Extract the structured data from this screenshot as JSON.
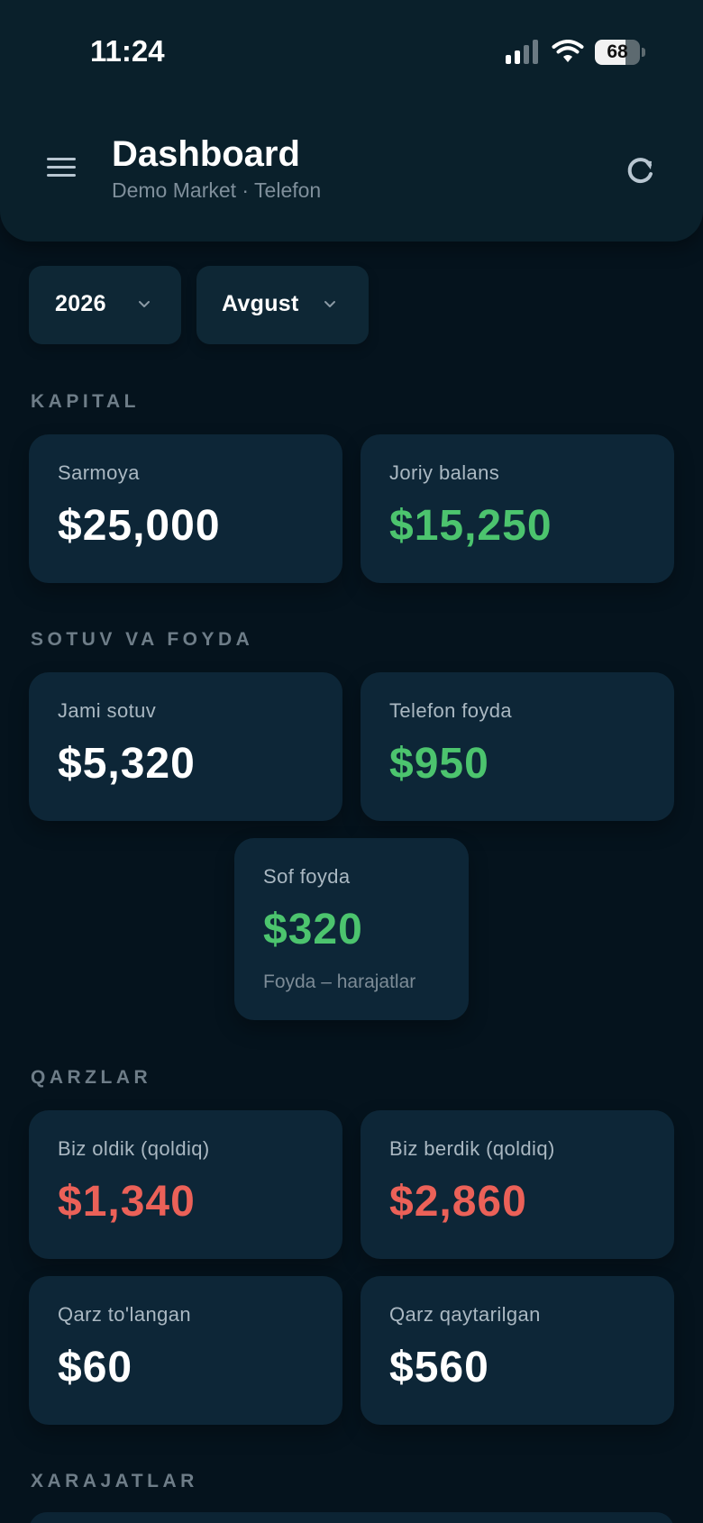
{
  "status_bar": {
    "time": "11:24",
    "battery_level": "68"
  },
  "header": {
    "title": "Dashboard",
    "subtitle": "Demo Market · Telefon"
  },
  "filters": {
    "year": "2026",
    "month": "Avgust"
  },
  "sections": {
    "capital": "KAPITAL",
    "sales_profit": "SOTUV VA FOYDA",
    "debts": "QARZLAR",
    "expenses": "XARAJATLAR"
  },
  "capital_cards": [
    {
      "label": "Sarmoya",
      "value": "$25,000"
    },
    {
      "label": "Joriy balans",
      "value": "$15,250"
    }
  ],
  "sales_cards": [
    {
      "label": "Jami sotuv",
      "value": "$5,320"
    },
    {
      "label": "Telefon foyda",
      "value": "$950"
    }
  ],
  "net_profit": {
    "label": "Sof foyda",
    "value": "$320",
    "note": "Foyda – harajatlar"
  },
  "debt_cards": [
    {
      "label": "Biz oldik (qoldiq)",
      "value": "$1,340"
    },
    {
      "label": "Biz berdik (qoldiq)",
      "value": "$2,860"
    },
    {
      "label": "Qarz to'langan",
      "value": "$60"
    },
    {
      "label": "Qarz qaytarilgan",
      "value": "$560"
    }
  ],
  "colors": {
    "background": "#05131d",
    "card": "#0d2637",
    "positive": "#4cc46e",
    "negative": "#eb6158",
    "text": "#ffffff"
  }
}
